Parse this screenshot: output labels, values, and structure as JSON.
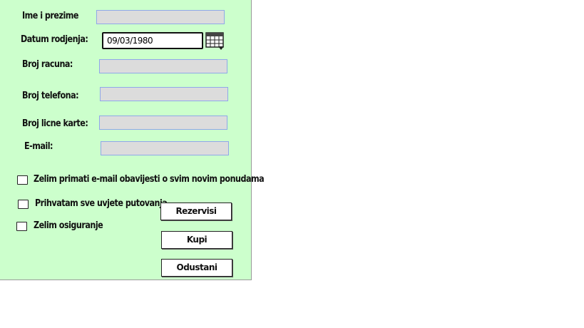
{
  "form": {
    "name_label": "Ime i prezime",
    "dob_label": "Datum rodjenja:",
    "dob_value": "09/03/1980",
    "account_label": "Broj racuna:",
    "phone_label": "Broj telefona:",
    "id_card_label": "Broj licne karte:",
    "email_label": "E-mail:"
  },
  "options": {
    "newsletter_label": "Zelim primati e-mail obavijesti o svim novim ponudama",
    "terms_label": "Prihvatam sve uvjete putovanja",
    "insurance_label": "Zelim osiguranje"
  },
  "buttons": {
    "reserve_label": "Rezervisi",
    "buy_label": "Kupi",
    "cancel_label": "Odustani"
  },
  "icons": {
    "calendar": "calendar-icon"
  },
  "colors": {
    "panel_background": "#ccffcc",
    "field_background": "#dcdcdc",
    "field_border": "#8fa8e8"
  }
}
